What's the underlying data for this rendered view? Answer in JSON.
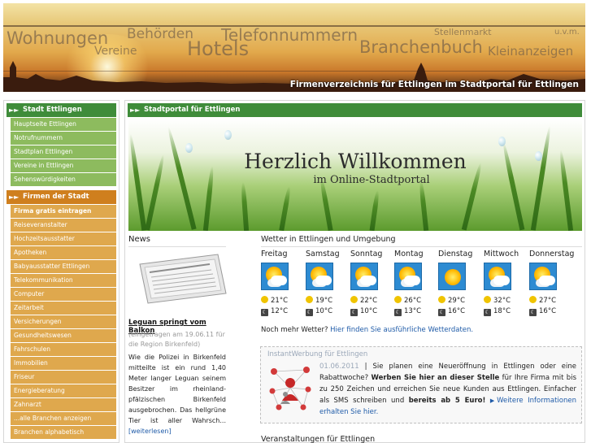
{
  "header": {
    "words": [
      "Wohnungen",
      "Behörden",
      "Telefonnummern",
      "Stellenmarkt",
      "u.v.m.",
      "Vereine",
      "Hotels",
      "Branchenbuch",
      "Kleinanzeigen"
    ],
    "subtitle": "Firmenverzeichnis für Ettlingen im Stadtportal für Ettlingen"
  },
  "sidebar": {
    "section1": {
      "title": "Stadt Ettlingen",
      "items": [
        "Hauptseite Ettlingen",
        "Notrufnummern",
        "Stadtplan Ettlingen",
        "Vereine in Ettlingen",
        "Sehenswürdigkeiten"
      ]
    },
    "section2": {
      "title": "Firmen der Stadt",
      "items": [
        "Firma gratis eintragen",
        "Reiseveranstalter",
        "Hochzeitsausstatter",
        "Apotheken",
        "Babyausstatter Ettlingen",
        "Telekommunikation",
        "Computer",
        "Zeitarbeit",
        "Versicherungen",
        "Gesundheitswesen",
        "Fahrschulen",
        "Immobilien",
        "Friseur",
        "Energieberatung",
        "Zahnarzt",
        "...alle Branchen anzeigen",
        "Branchen alphabetisch"
      ]
    }
  },
  "main": {
    "header": "Stadtportal für Ettlingen",
    "welcome": {
      "title": "Herzlich Willkommen",
      "subtitle": "im Online-Stadtportal"
    }
  },
  "news": {
    "title": "News",
    "headline": "Leguan springt vom Balkon",
    "meta": "(eingetragen am 19.06.11 für die Region Birkenfeld)",
    "body": "Wie die Polizei in Birkenfeld mitteilte ist ein rund 1,40 Meter langer Leguan seinem Besitzer im rheinland-pfälzischen Birkenfeld ausgebrochen. Das hellgrüne Tier ist aller Wahrsch...",
    "more": "[weiterlesen]"
  },
  "weather": {
    "title": "Wetter in Ettlingen und Umgebung",
    "days": [
      {
        "name": "Freitag",
        "high": "21°C",
        "low": "12°C"
      },
      {
        "name": "Samstag",
        "high": "19°C",
        "low": "10°C"
      },
      {
        "name": "Sonntag",
        "high": "22°C",
        "low": "10°C"
      },
      {
        "name": "Montag",
        "high": "26°C",
        "low": "13°C"
      },
      {
        "name": "Dienstag",
        "high": "29°C",
        "low": "16°C"
      },
      {
        "name": "Mittwoch",
        "high": "32°C",
        "low": "18°C"
      },
      {
        "name": "Donnerstag",
        "high": "27°C",
        "low": "16°C"
      }
    ],
    "more_text": "Noch mehr Wetter?",
    "more_link": "Hier finden Sie ausführliche Wetterdaten."
  },
  "ad": {
    "label": "InstantWerbung für Ettlingen",
    "date": "01.06.2011",
    "sep": " | Sie planen eine Neueröffnung in Ettlingen oder eine Rabattwoche? ",
    "bold1": "Werben Sie hier an dieser Stelle",
    "mid": " für Ihre Firma mit bis zu 250 Zeichen und erreichen Sie neue Kunden aus Ettlingen. Einfacher als SMS schreiben und ",
    "bold2": "bereits ab 5 Euro!",
    "link": "Weitere Informationen erhalten Sie hier."
  },
  "events": {
    "title": "Veranstaltungen für Ettlingen"
  }
}
